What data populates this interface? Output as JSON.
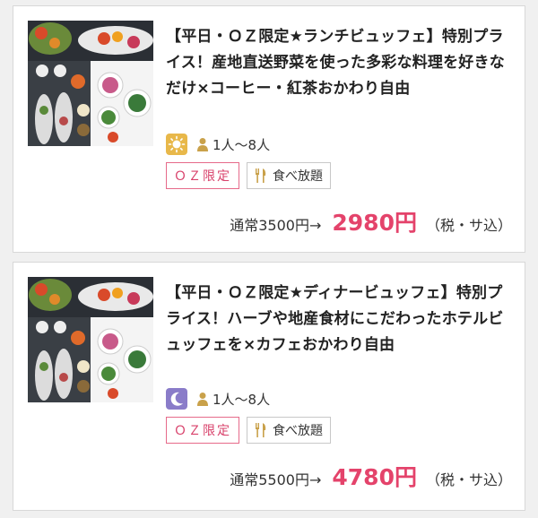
{
  "plans": [
    {
      "title": "【平日・ＯＺ限定★ランチビュッフェ】特別プライス！産地直送野菜を使った多彩な料理を好きなだけ×コーヒー・紅茶おかわり自由",
      "time_icon": "sun-icon",
      "people": "1人〜8人",
      "tags": {
        "oz": "ＯＺ限定",
        "buffet": "食べ放題"
      },
      "regular_price": "通常3500円→",
      "price": "2980円",
      "tax": "（税・サ込）"
    },
    {
      "title": "【平日・ＯＺ限定★ディナービュッフェ】特別プライス！ハーブや地産食材にこだわったホテルビュッフェを×カフェおかわり自由",
      "time_icon": "moon-icon",
      "people": "1人〜8人",
      "tags": {
        "oz": "ＯＺ限定",
        "buffet": "食べ放題"
      },
      "regular_price": "通常5500円→",
      "price": "4780円",
      "tax": "（税・サ込）"
    }
  ],
  "colors": {
    "accent_pink": "#e4436b",
    "sun_icon_bg": "#e8b84a",
    "moon_icon_bg": "#8a7cc9",
    "gold": "#c9a14a"
  }
}
